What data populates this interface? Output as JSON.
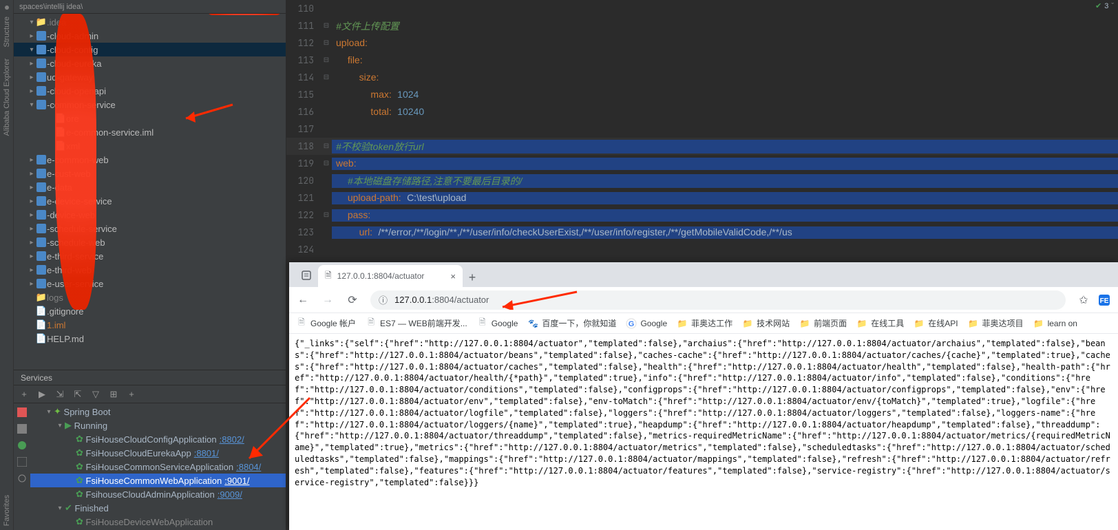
{
  "breadcrumb": {
    "parts": "spaces\\intellij idea\\"
  },
  "vtabs": {
    "t1": "Structure",
    "t2": "Alibaba Cloud Explorer",
    "t3": "Favorites"
  },
  "editorStatus": {
    "warn": "3"
  },
  "tree": [
    {
      "ind": 0,
      "chev": "▾",
      "type": "folder",
      "label": ".idea",
      "grey": true
    },
    {
      "ind": 0,
      "chev": "▸",
      "type": "module",
      "label": "-cloud-admin"
    },
    {
      "ind": 0,
      "chev": "▾",
      "type": "module",
      "label": "-cloud-config",
      "sel": true
    },
    {
      "ind": 0,
      "chev": "▸",
      "type": "module",
      "label": "-cloud-eureka"
    },
    {
      "ind": 0,
      "chev": "▸",
      "type": "module",
      "label": "ud-gateway"
    },
    {
      "ind": 0,
      "chev": "▸",
      "type": "module",
      "label": "-cloud-openapi"
    },
    {
      "ind": 0,
      "chev": "▾",
      "type": "module",
      "label": "-common-service"
    },
    {
      "ind": 2,
      "chev": "",
      "type": "file",
      "label": "ore"
    },
    {
      "ind": 2,
      "chev": "",
      "type": "file",
      "label": "e-common-service.iml"
    },
    {
      "ind": 2,
      "chev": "",
      "type": "file",
      "label": "xml"
    },
    {
      "ind": 0,
      "chev": "▸",
      "type": "module",
      "label": "e-common-web"
    },
    {
      "ind": 0,
      "chev": "▸",
      "type": "module",
      "label": "e-cust-web"
    },
    {
      "ind": 0,
      "chev": "▸",
      "type": "module",
      "label": "e-data"
    },
    {
      "ind": 0,
      "chev": "▸",
      "type": "module",
      "label": "e-device-service"
    },
    {
      "ind": 0,
      "chev": "▸",
      "type": "module",
      "label": "-device-web"
    },
    {
      "ind": 0,
      "chev": "▸",
      "type": "module",
      "label": "-schedule-service"
    },
    {
      "ind": 0,
      "chev": "▸",
      "type": "module",
      "label": "-schedule-web"
    },
    {
      "ind": 0,
      "chev": "▸",
      "type": "module",
      "label": "e-third-service"
    },
    {
      "ind": 0,
      "chev": "▸",
      "type": "module",
      "label": "e-third-web"
    },
    {
      "ind": 0,
      "chev": "▸",
      "type": "module",
      "label": "e-user-service"
    },
    {
      "ind": 0,
      "chev": "",
      "type": "folder",
      "label": "logs",
      "grey": true
    },
    {
      "ind": 0,
      "chev": "",
      "type": "file",
      "label": ".gitignore"
    },
    {
      "ind": 0,
      "chev": "",
      "type": "file",
      "label": "1.iml",
      "red": true
    },
    {
      "ind": 0,
      "chev": "",
      "type": "file",
      "label": "HELP.md"
    }
  ],
  "lines": [
    {
      "n": "110",
      "html": ""
    },
    {
      "n": "111",
      "html": "<span class='cm'>#文件上传配置</span>",
      "fold": "⊟"
    },
    {
      "n": "112",
      "html": "<span class='key'>upload</span><span class='op'>:</span>",
      "fold": "⊟"
    },
    {
      "n": "113",
      "html": "  <span class='key'>file</span><span class='op'>:</span>",
      "fold": "⊟"
    },
    {
      "n": "114",
      "html": "    <span class='key'>size</span><span class='op'>:</span>",
      "fold": "⊟"
    },
    {
      "n": "115",
      "html": "      <span class='key'>max</span><span class='op'>:</span> <span class='val'>1024</span>"
    },
    {
      "n": "116",
      "html": "      <span class='key'>total</span><span class='op'>:</span> <span class='val'>10240</span>"
    },
    {
      "n": "117",
      "html": ""
    },
    {
      "n": "118",
      "html": "<span class='cm'>#不校验token放行url</span>",
      "sel": true,
      "cur": true,
      "fold": "⊟"
    },
    {
      "n": "119",
      "html": "<span class='key'>web</span><span class='op'>:</span>",
      "sel": true,
      "fold": "⊟"
    },
    {
      "n": "120",
      "html": "  <span class='cm'>#本地磁盘存储路径,注意不要最后目录的/</span>",
      "sel": true
    },
    {
      "n": "121",
      "html": "  <span class='key'>upload-path</span><span class='op'>:</span> <span class='plain'>C:\\test\\upload</span>",
      "sel": true
    },
    {
      "n": "122",
      "html": "  <span class='key'>pass</span><span class='op'>:</span>",
      "sel": true,
      "fold": "⊟"
    },
    {
      "n": "123",
      "html": "    <span class='key'>url</span><span class='op'>:</span> <span class='plain'>/**/error,/**/login/**,/**/user/info/checkUserExist,/**/user/info/register,/**/getMobileValidCode,/**/us</span>",
      "sel": true
    },
    {
      "n": "124",
      "html": ""
    }
  ],
  "browser": {
    "tabTitle": "127.0.0.1:8804/actuator",
    "urlHost": "127.0.0.1",
    "urlPort": ":8804",
    "urlPath": "/actuator",
    "bookmarks": [
      {
        "ico": "page",
        "label": "Google 帐户"
      },
      {
        "ico": "page",
        "label": "ES7 — WEB前端开发..."
      },
      {
        "ico": "page",
        "label": "Google"
      },
      {
        "ico": "baidu",
        "label": "百度一下，你就知道"
      },
      {
        "ico": "g",
        "label": "Google"
      },
      {
        "ico": "folder",
        "label": "菲奥达工作"
      },
      {
        "ico": "folder",
        "label": "技术网站"
      },
      {
        "ico": "folder",
        "label": "前端页面"
      },
      {
        "ico": "folder",
        "label": "在线工具"
      },
      {
        "ico": "folder",
        "label": "在线API"
      },
      {
        "ico": "folder",
        "label": "菲奥达项目"
      },
      {
        "ico": "folder",
        "label": "learn on"
      }
    ],
    "body": "{\"_links\":{\"self\":{\"href\":\"http://127.0.0.1:8804/actuator\",\"templated\":false},\"archaius\":{\"href\":\"http://127.0.0.1:8804/actuator/archaius\",\"templated\":false},\"beans\":{\"href\":\"http://127.0.0.1:8804/actuator/beans\",\"templated\":false},\"caches-cache\":{\"href\":\"http://127.0.0.1:8804/actuator/caches/{cache}\",\"templated\":true},\"caches\":{\"href\":\"http://127.0.0.1:8804/actuator/caches\",\"templated\":false},\"health\":{\"href\":\"http://127.0.0.1:8804/actuator/health\",\"templated\":false},\"health-path\":{\"href\":\"http://127.0.0.1:8804/actuator/health/{*path}\",\"templated\":true},\"info\":{\"href\":\"http://127.0.0.1:8804/actuator/info\",\"templated\":false},\"conditions\":{\"href\":\"http://127.0.0.1:8804/actuator/conditions\",\"templated\":false},\"configprops\":{\"href\":\"http://127.0.0.1:8804/actuator/configprops\",\"templated\":false},\"env\":{\"href\":\"http://127.0.0.1:8804/actuator/env\",\"templated\":false},\"env-toMatch\":{\"href\":\"http://127.0.0.1:8804/actuator/env/{toMatch}\",\"templated\":true},\"logfile\":{\"href\":\"http://127.0.0.1:8804/actuator/logfile\",\"templated\":false},\"loggers\":{\"href\":\"http://127.0.0.1:8804/actuator/loggers\",\"templated\":false},\"loggers-name\":{\"href\":\"http://127.0.0.1:8804/actuator/loggers/{name}\",\"templated\":true},\"heapdump\":{\"href\":\"http://127.0.0.1:8804/actuator/heapdump\",\"templated\":false},\"threaddump\":{\"href\":\"http://127.0.0.1:8804/actuator/threaddump\",\"templated\":false},\"metrics-requiredMetricName\":{\"href\":\"http://127.0.0.1:8804/actuator/metrics/{requiredMetricName}\",\"templated\":true},\"metrics\":{\"href\":\"http://127.0.0.1:8804/actuator/metrics\",\"templated\":false},\"scheduledtasks\":{\"href\":\"http://127.0.0.1:8804/actuator/scheduledtasks\",\"templated\":false},\"mappings\":{\"href\":\"http://127.0.0.1:8804/actuator/mappings\",\"templated\":false},\"refresh\":{\"href\":\"http://127.0.0.1:8804/actuator/refresh\",\"templated\":false},\"features\":{\"href\":\"http://127.0.0.1:8804/actuator/features\",\"templated\":false},\"service-registry\":{\"href\":\"http://127.0.0.1:8804/actuator/service-registry\",\"templated\":false}}}"
  },
  "services": {
    "title": "Services",
    "root": "Spring Boot",
    "running": "Running",
    "finished": "Finished",
    "apps": [
      {
        "name": "FsiHouseCloudConfigApplication",
        "port": ":8802/"
      },
      {
        "name": "FsiHouseCloudEurekaApp",
        "port": ":8801/"
      },
      {
        "name": "FsiHouseCommonServiceApplication",
        "port": ":8804/"
      },
      {
        "name": "FsiHouseCommonWebApplication",
        "port": ":9001/",
        "sel": true
      },
      {
        "name": "FsihouseCloudAdminApplication",
        "port": ":9009/"
      }
    ],
    "finApp": {
      "name": "FsiHouseDeviceWebApplication"
    }
  },
  "watermark": ""
}
